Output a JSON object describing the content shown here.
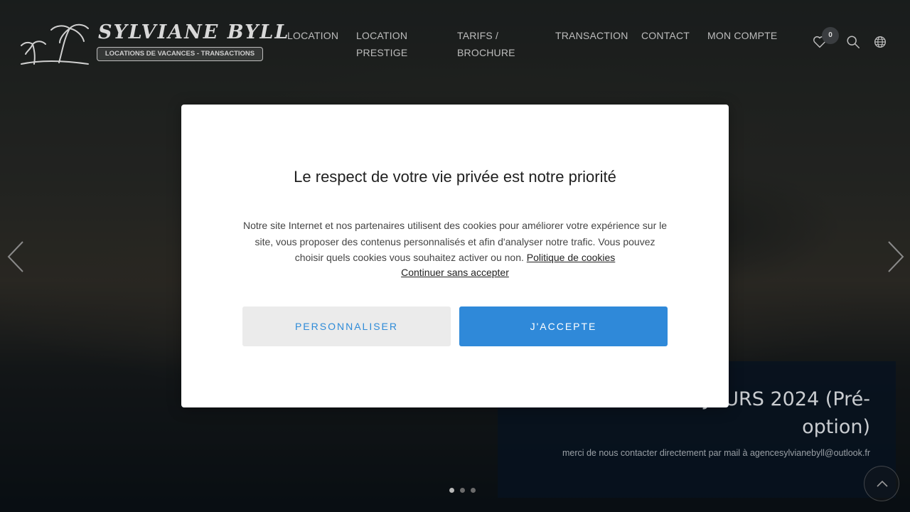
{
  "header": {
    "logo": {
      "title": "SYLVIANE BYLL",
      "tagline": "LOCATIONS DE VACANCES - TRANSACTIONS"
    },
    "nav": [
      {
        "line1": "LOCATION",
        "line2": ""
      },
      {
        "line1": "LOCATION",
        "line2": "PRESTIGE"
      },
      {
        "line1": "TARIFS /",
        "line2": "BROCHURE"
      },
      {
        "line1": "TRANSACTION",
        "line2": ""
      },
      {
        "line1": "CONTACT",
        "line2": ""
      },
      {
        "line1": "MON COMPTE",
        "line2": ""
      }
    ],
    "favorites_count": "0",
    "icons": [
      "heart-icon",
      "search-icon",
      "globe-icon"
    ]
  },
  "hero": {
    "caption_title": "demandes de SEJOURS 2024 (Pré-option)",
    "caption_sub": "merci de nous contacter directement par mail à agencesylvianebyll@outlook.fr",
    "slides_count": 3,
    "active_slide": 1
  },
  "cookie_modal": {
    "title": "Le respect de votre vie privée est notre priorité",
    "body": "Notre site Internet et nos partenaires utilisent des cookies pour améliorer votre expérience sur le site, vous proposer des contenus personnalisés et afin d'analyser notre trafic. Vous pouvez choisir quels cookies vous souhaitez activer ou non.",
    "policy_link": "Politique de cookies",
    "continue_link": "Continuer sans accepter",
    "customize_label": "PERSONNALISER",
    "accept_label": "J'ACCEPTE"
  },
  "colors": {
    "accent": "#2f89d9",
    "secondary_button_bg": "#ebebeb",
    "caption_bg": "#061220"
  }
}
